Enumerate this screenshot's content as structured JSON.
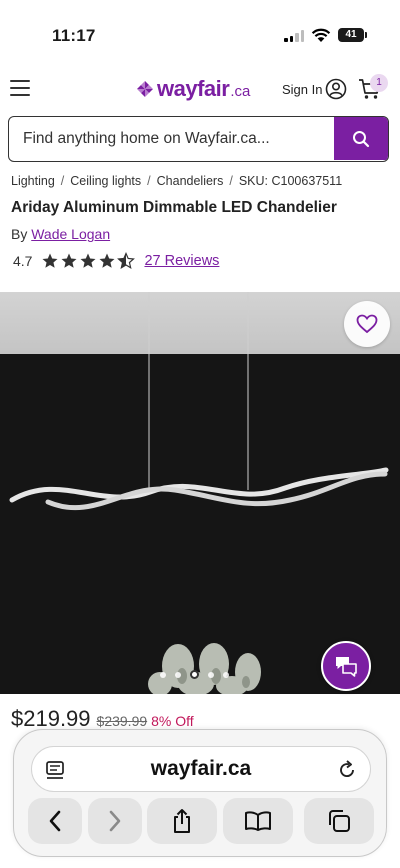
{
  "status_bar": {
    "time": "11:17",
    "battery": "41"
  },
  "header": {
    "logo_text": "wayfair",
    "logo_suffix": ".ca",
    "sign_in": "Sign In",
    "cart_count": "1",
    "brand_color": "#7b1fa2"
  },
  "search": {
    "placeholder": "Find anything home on Wayfair.ca..."
  },
  "breadcrumb": {
    "items": [
      "Lighting",
      "Ceiling lights",
      "Chandeliers"
    ],
    "sku": "SKU: C100637511"
  },
  "product": {
    "title": "Ariday Aluminum Dimmable LED Chandelier",
    "by_label": "By",
    "brand": "Wade Logan",
    "rating": "4.7",
    "rating_value": 4.7,
    "reviews": "27 Reviews",
    "price": "$219.99",
    "was_price": "$239.99",
    "discount": "8% Off"
  },
  "carousel": {
    "count": 5,
    "active": 2
  },
  "browser": {
    "url": "wayfair.ca"
  },
  "icons": {
    "menu": "hamburger-icon",
    "logo": "pinwheel-logo-icon",
    "user": "user-icon",
    "cart": "cart-icon",
    "search": "search-icon",
    "favorite": "heart-icon",
    "chat": "chat-icon",
    "reader": "reader-icon",
    "reload": "reload-icon",
    "back": "chevron-left-icon",
    "forward": "chevron-right-icon",
    "share": "share-icon",
    "bookmarks": "book-icon",
    "tabs": "tabs-icon"
  }
}
